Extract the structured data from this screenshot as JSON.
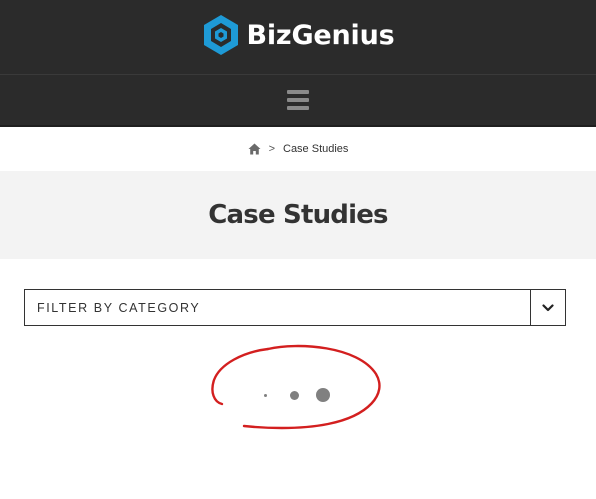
{
  "header": {
    "brand_name": "BizGenius",
    "logo_icon": "hexagon-logo-icon",
    "brand_color": "#1e9ad6"
  },
  "navbar": {
    "menu_icon": "hamburger-menu-icon"
  },
  "breadcrumb": {
    "home_icon": "home-icon",
    "separator": ">",
    "current": "Case Studies"
  },
  "page": {
    "title": "Case Studies"
  },
  "filter": {
    "label": "FILTER BY CATEGORY",
    "toggle_icon": "chevron-down-icon"
  },
  "loader": {
    "icon": "loading-dots-icon",
    "annotation_color": "#d31f1f"
  }
}
